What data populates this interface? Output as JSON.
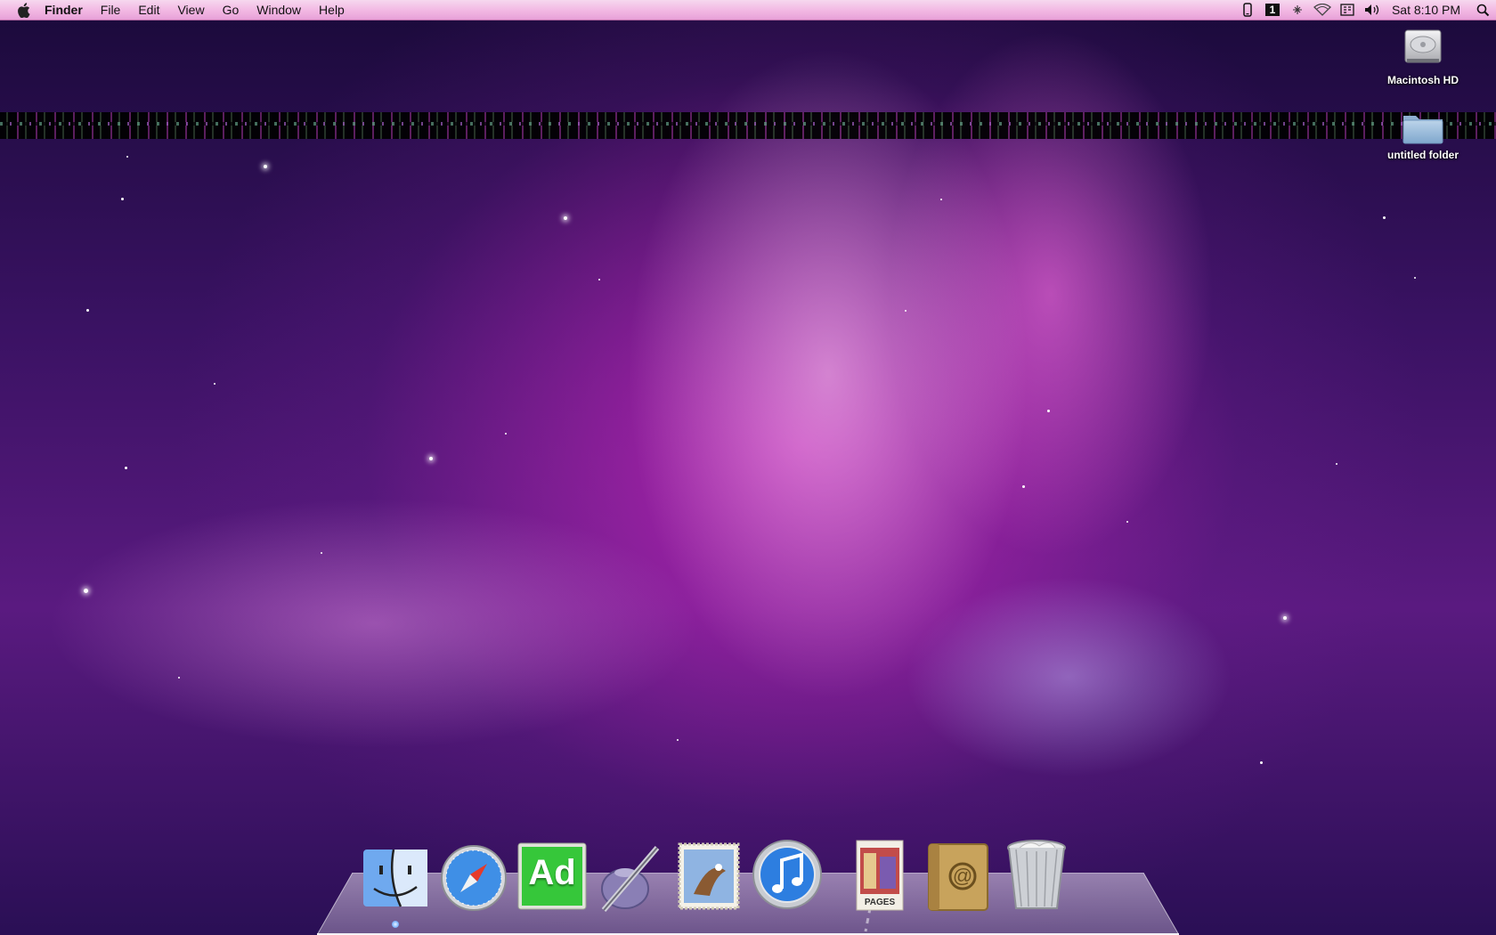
{
  "menubar": {
    "app_name": "Finder",
    "menus": [
      "File",
      "Edit",
      "View",
      "Go",
      "Window",
      "Help"
    ],
    "status_icons": [
      "phone-icon",
      "spaces-number-icon",
      "bluetooth-icon",
      "wifi-icon",
      "input-menu-icon",
      "volume-icon"
    ],
    "spaces_number": "1",
    "clock": "Sat 8:10 PM"
  },
  "desktop": {
    "icons": [
      {
        "label": "Macintosh HD",
        "icon": "hard-drive-icon"
      },
      {
        "label": "untitled folder",
        "icon": "folder-icon"
      }
    ]
  },
  "dock": {
    "items": [
      {
        "name": "Finder",
        "icon": "finder-icon",
        "running": true
      },
      {
        "name": "Safari",
        "icon": "safari-icon",
        "running": false
      },
      {
        "name": "Ad",
        "icon": "ad-app-icon",
        "label": "Ad",
        "running": false
      },
      {
        "name": "Script Editor",
        "icon": "pen-inkwell-icon",
        "running": false
      },
      {
        "name": "Mail",
        "icon": "mail-stamp-icon",
        "running": false
      },
      {
        "name": "iTunes",
        "icon": "itunes-icon",
        "running": false
      },
      {
        "name": "Pages Document",
        "icon": "pages-document-icon",
        "label": "PAGES",
        "running": false
      },
      {
        "name": "Address Book",
        "icon": "address-book-icon",
        "running": false
      },
      {
        "name": "Trash",
        "icon": "trash-icon",
        "running": false
      }
    ]
  }
}
